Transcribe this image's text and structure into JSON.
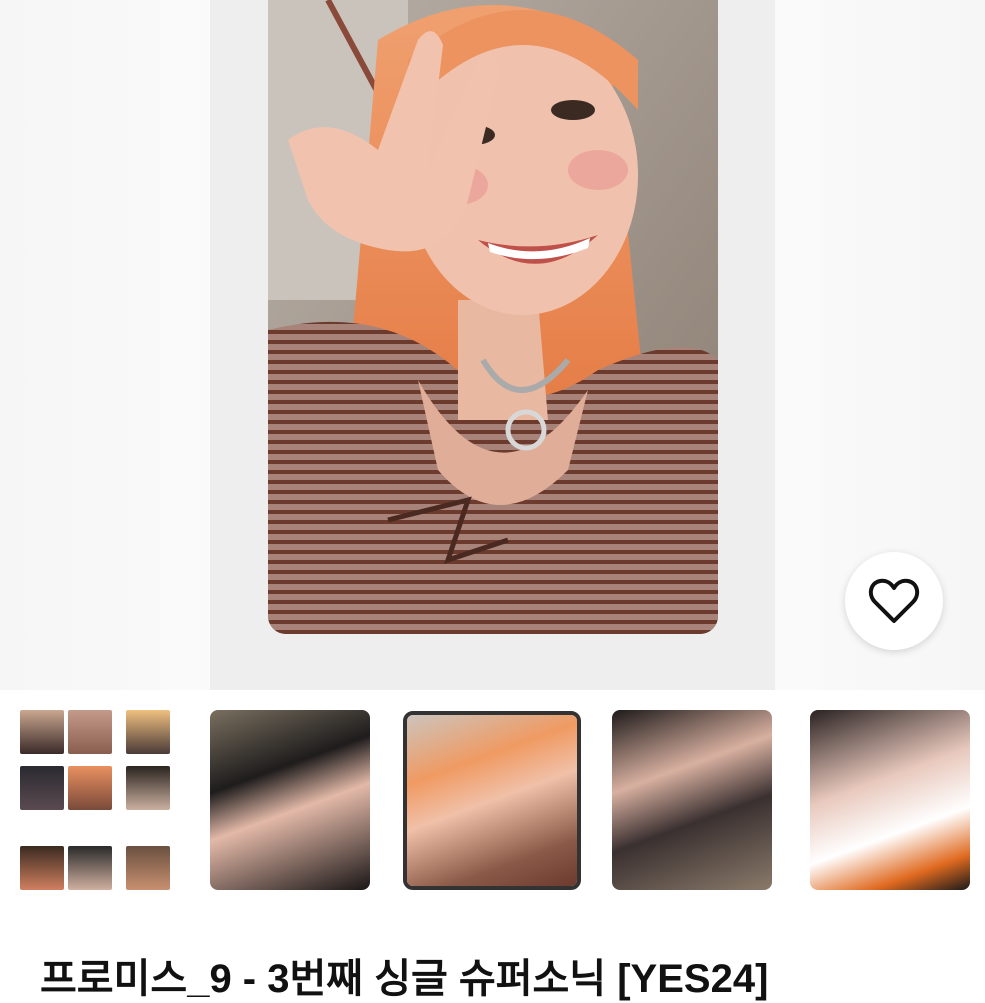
{
  "product": {
    "title": "프로미스_9 - 3번째 싱글 슈퍼소닉 [YES24]"
  },
  "gallery": {
    "favorite_icon": "heart-outline-icon",
    "thumbnails": [
      {
        "label": "collage",
        "selected": false
      },
      {
        "label": "photo-2",
        "selected": false
      },
      {
        "label": "photo-3",
        "selected": true
      },
      {
        "label": "photo-4",
        "selected": false
      },
      {
        "label": "photo-5",
        "selected": false
      }
    ]
  },
  "colors": {
    "selected_border": "#333333",
    "card_brown": "#6a4a3a",
    "hair_orange": "#e88a55"
  }
}
